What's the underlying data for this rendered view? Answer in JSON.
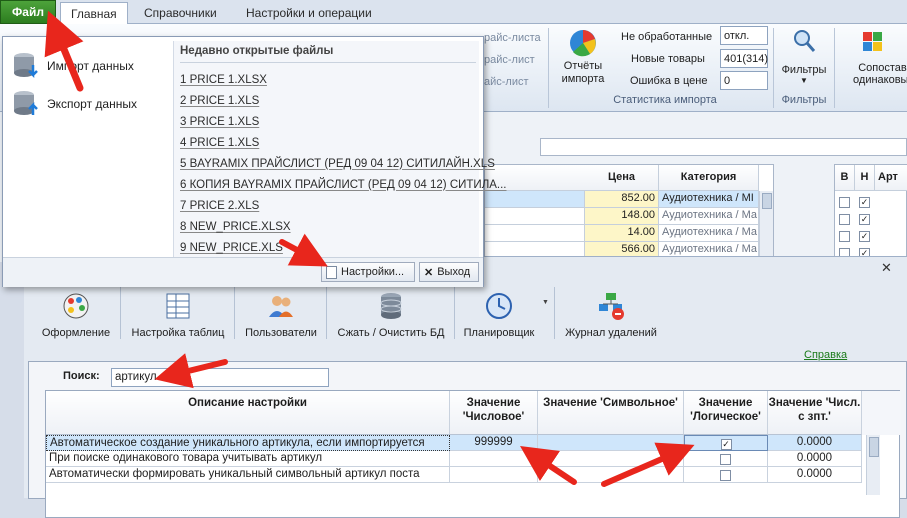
{
  "tabs": {
    "file": "Файл",
    "items": [
      "Главная",
      "Справочники",
      "Настройки и операции"
    ]
  },
  "ribbon": {
    "partial_price_list_1": "райс-листа",
    "partial_price_list_2": "райс-лист",
    "partial_price_list_3": "айс-лист",
    "reports_button": "Отчёты импорта",
    "stats": {
      "not_processed_label": "Не обработанные",
      "not_processed_value": "откл.",
      "new_products_label": "Новые товары",
      "new_products_value": "401(314)",
      "price_error_label": "Ошибка в цене",
      "price_error_value": "0",
      "caption": "Статистика импорта"
    },
    "filters_button": "Фильтры",
    "filters_caption": "Фильтры",
    "compare_button_line1": "Сопостав",
    "compare_button_line2": "одинаковых"
  },
  "grid": {
    "headers": {
      "price": "Цена",
      "category": "Категория"
    },
    "rows": [
      {
        "price": "852.00",
        "category": "Аудиотехника / МІ"
      },
      {
        "price": "148.00",
        "category": "Аудиотехника / Ма"
      },
      {
        "price": "14.00",
        "category": "Аудиотехника / Ма"
      },
      {
        "price": "566.00",
        "category": "Аудиотехника / Ма"
      }
    ],
    "right_headers": [
      "В",
      "Н",
      "Арт"
    ]
  },
  "file_menu": {
    "import": "Импорт данных",
    "export": "Экспорт данных",
    "recent_title": "Недавно открытые файлы",
    "recent": [
      "1 PRICE 1.XLSX",
      "2 PRICE 1.XLS",
      "3 PRICE 1.XLS",
      "4 PRICE 1.XLS",
      "5 BAYRAMIX ПРАЙСЛИСТ (РЕД 09 04 12) СИТИЛАЙН.XLS",
      "6 КОПИЯ BAYRAMIX ПРАЙСЛИСТ (РЕД 09 04 12) СИТИЛА...",
      "7 PRICE 2.XLS",
      "8 NEW_PRICE.XLSX",
      "9 NEW_PRICE.XLS"
    ],
    "settings_button": "Настройки...",
    "exit_button": "Выход"
  },
  "dialog": {
    "close": "✕",
    "toolbar": [
      "Оформление",
      "Настройка таблиц",
      "Пользователи",
      "Сжать / Очистить БД",
      "Планировщик",
      "Журнал удалений"
    ],
    "help_link": "Справка",
    "search_label": "Поиск:",
    "search_value": "артикул",
    "table": {
      "headers": {
        "description": "Описание настройки",
        "numeric": "Значение 'Числовое'",
        "symbolic": "Значение 'Символьное'",
        "logical": "Значение 'Логическое'",
        "float": "Значение 'Числ. с зпт.'"
      },
      "rows": [
        {
          "description": "Автоматическое создание уникального артикула, если импортируется",
          "numeric": "999999",
          "symbolic": "",
          "logical": true,
          "float": "0.0000"
        },
        {
          "description": "При поиске одинакового товара учитывать артикул",
          "numeric": "",
          "symbolic": "",
          "logical": false,
          "float": "0.0000"
        },
        {
          "description": "Автоматически формировать уникальный символьный артикул поста",
          "numeric": "",
          "symbolic": "",
          "logical": false,
          "float": "0.0000"
        }
      ]
    }
  },
  "colors": {
    "file_tab": "#3a8f2c",
    "annotation_arrow": "#e8261c",
    "link": "#1a7a1a",
    "selected_row": "#cfe6fb"
  }
}
